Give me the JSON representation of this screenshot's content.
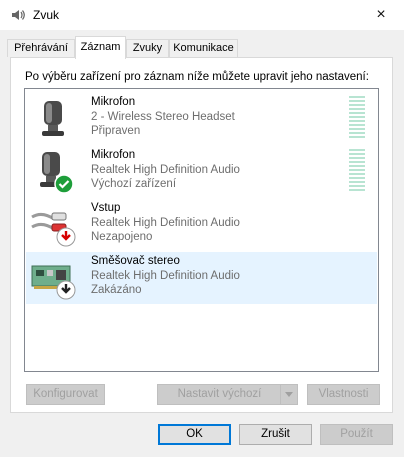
{
  "window": {
    "title": "Zvuk",
    "close_icon": "×"
  },
  "tabs": [
    {
      "label": "Přehrávání"
    },
    {
      "label": "Záznam",
      "active": true
    },
    {
      "label": "Zvuky"
    },
    {
      "label": "Komunikace"
    }
  ],
  "instruction": "Po výběru zařízení pro záznam níže můžete upravit jeho nastavení:",
  "devices": [
    {
      "name": "Mikrofon",
      "desc": "2 - Wireless Stereo Headset",
      "status": "Připraven",
      "icon": "headset-mic-icon",
      "level": 0
    },
    {
      "name": "Mikrofon",
      "desc": "Realtek High Definition Audio",
      "status": "Výchozí zařízení",
      "icon": "microphone-default-icon",
      "level": 0
    },
    {
      "name": "Vstup",
      "desc": "Realtek High Definition Audio",
      "status": "Nezapojeno",
      "icon": "rca-input-icon"
    },
    {
      "name": "Směšovač stereo",
      "desc": "Realtek High Definition Audio",
      "status": "Zakázáno",
      "icon": "sound-card-icon"
    }
  ],
  "buttons": {
    "configure": "Konfigurovat",
    "set_default": "Nastavit výchozí",
    "properties": "Vlastnosti",
    "ok": "OK",
    "cancel": "Zrušit",
    "apply": "Použít"
  },
  "colors": {
    "selected_row": "#e5f3ff",
    "ok_border": "#0078d7",
    "check_badge": "#1e9e3a",
    "warning_arrow": "#d60000"
  }
}
